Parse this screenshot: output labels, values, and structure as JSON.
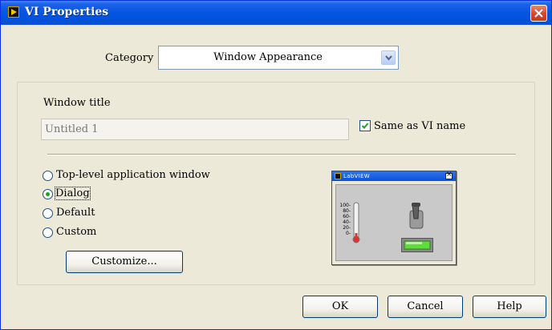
{
  "window": {
    "title": "VI Properties"
  },
  "category": {
    "label": "Category",
    "selected": "Window Appearance"
  },
  "window_title": {
    "label": "Window title",
    "value": "Untitled 1",
    "same_as_vi_name_label": "Same as VI name",
    "same_as_vi_name_checked": true
  },
  "window_type": {
    "options": [
      {
        "label": "Top-level application window",
        "checked": false
      },
      {
        "label": "Dialog",
        "checked": true
      },
      {
        "label": "Default",
        "checked": false
      },
      {
        "label": "Custom",
        "checked": false
      }
    ],
    "customize_label": "Customize..."
  },
  "preview": {
    "title": "LabVIEW",
    "scale_labels": [
      "100-",
      "80-",
      "60-",
      "40-",
      "20-",
      "0-"
    ]
  },
  "buttons": {
    "ok": "OK",
    "cancel": "Cancel",
    "help": "Help"
  },
  "colors": {
    "title_bar": "#0a58e3",
    "window_bg": "#ece9d8",
    "close_button": "#d8462a",
    "radio_dot": "#21a121",
    "thermometer_fill": "#e03030",
    "led_on": "#5fdc3c"
  }
}
